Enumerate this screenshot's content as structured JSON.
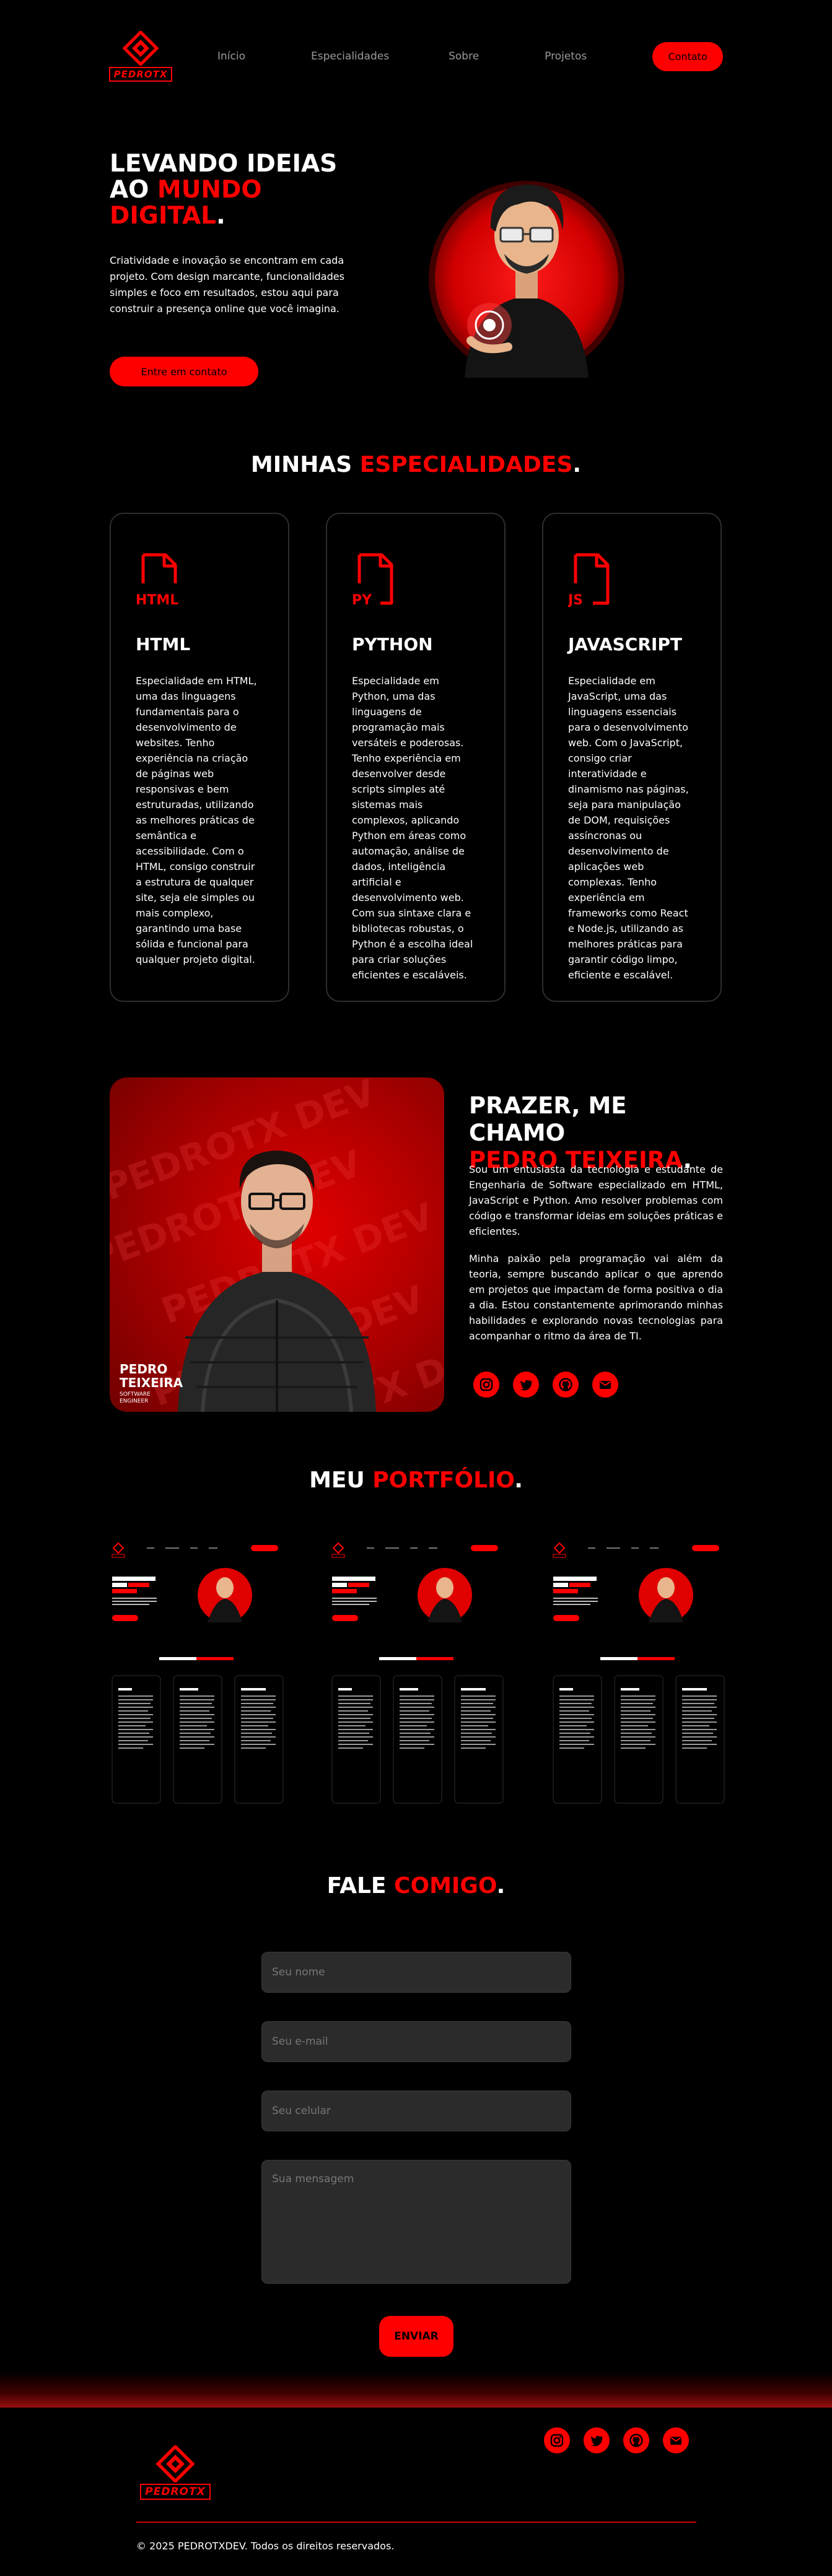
{
  "colors": {
    "accent": "#ff0000",
    "background": "#000000",
    "card_border": "#2e2e2e",
    "field_bg": "#2b2b2b"
  },
  "brand": {
    "logo_text": "PEDROTX"
  },
  "nav": {
    "links": [
      "Início",
      "Especialidades",
      "Sobre",
      "Projetos"
    ],
    "cta": "Contato"
  },
  "hero": {
    "title_line1": "LEVANDO IDEIAS",
    "title_line2_white": "AO ",
    "title_line2_red": "MUNDO",
    "title_line3_red": "DIGITAL",
    "title_dot": ".",
    "text": "Criatividade e inovação se encontram em cada projeto. Com design marcante, funcionalidades simples e foco em resultados, estou aqui para construir a presença online que você imagina.",
    "button": "Entre em contato"
  },
  "specialties": {
    "title_white": "MINHAS ",
    "title_red": "ESPECIALIDADES",
    "title_dot": ".",
    "cards": [
      {
        "icon_label": "HTML",
        "icon": "html-file-icon",
        "title": "HTML",
        "text": "Especialidade em HTML, uma das linguagens fundamentais para o desenvolvimento de websites. Tenho experiência na criação de páginas web responsivas e bem estruturadas, utilizando as melhores práticas de semântica e acessibilidade. Com o HTML, consigo construir a estrutura de qualquer site, seja ele simples ou mais complexo, garantindo uma base sólida e funcional para qualquer projeto digital."
      },
      {
        "icon_label": "PY",
        "icon": "python-file-icon",
        "title": "PYTHON",
        "text": "Especialidade em Python, uma das linguagens de programação mais versáteis e poderosas. Tenho experiência em desenvolver desde scripts simples até sistemas mais complexos, aplicando Python em áreas como automação, análise de dados, inteligência artificial e desenvolvimento web. Com sua sintaxe clara e bibliotecas robustas, o Python é a escolha ideal para criar soluções eficientes e escaláveis."
      },
      {
        "icon_label": "JS",
        "icon": "javascript-file-icon",
        "title": "JAVASCRIPT",
        "text": "Especialidade em JavaScript, uma das linguagens essenciais para o desenvolvimento web. Com o JavaScript, consigo criar interatividade e dinamismo nas páginas, seja para manipulação de DOM, requisições assíncronas ou desenvolvimento de aplicações web complexas. Tenho experiência em frameworks como React e Node.js, utilizando as melhores práticas para garantir código limpo, eficiente e escalável."
      }
    ]
  },
  "about": {
    "photo_watermark": "PEDROTX DEV",
    "photo_name_line1": "PEDRO",
    "photo_name_line2": "TEIXEIRA",
    "photo_role_line1": "SOFTWARE",
    "photo_role_line2": "ENGINEER",
    "title_line1": "PRAZER, ME CHAMO",
    "title_line2_red": "PEDRO TEIXEIRA",
    "title_dot": ".",
    "p1": "Sou um entusiasta da tecnologia e estudante de Engenharia de Software especializado em HTML, JavaScript e Python. Amo resolver problemas com código e transformar ideias em soluções práticas e eficientes.",
    "p2": "Minha paixão pela programação vai além da teoria, sempre buscando aplicar o que aprendo em projetos que impactam de forma positiva o dia a dia. Estou constantemente aprimorando minhas habilidades e explorando novas tecnologias para acompanhar o ritmo da área de TI.",
    "socials": [
      "instagram-icon",
      "twitter-icon",
      "github-icon",
      "email-icon"
    ]
  },
  "portfolio": {
    "title_white": "MEU ",
    "title_red": "PORTFÓLIO",
    "title_dot": ".",
    "items": [
      "project-thumbnail-1",
      "project-thumbnail-2",
      "project-thumbnail-3"
    ]
  },
  "contact": {
    "title_white": "FALE ",
    "title_red": "COMIGO",
    "title_dot": ".",
    "name_placeholder": "Seu nome",
    "email_placeholder": "Seu e-mail",
    "phone_placeholder": "Seu celular",
    "message_placeholder": "Sua mensagem",
    "submit": "ENVIAR"
  },
  "footer": {
    "copyright": "© 2025 PEDROTXDEV. Todos os direitos reservados.",
    "socials": [
      "instagram-icon",
      "twitter-icon",
      "github-icon",
      "email-icon"
    ]
  }
}
